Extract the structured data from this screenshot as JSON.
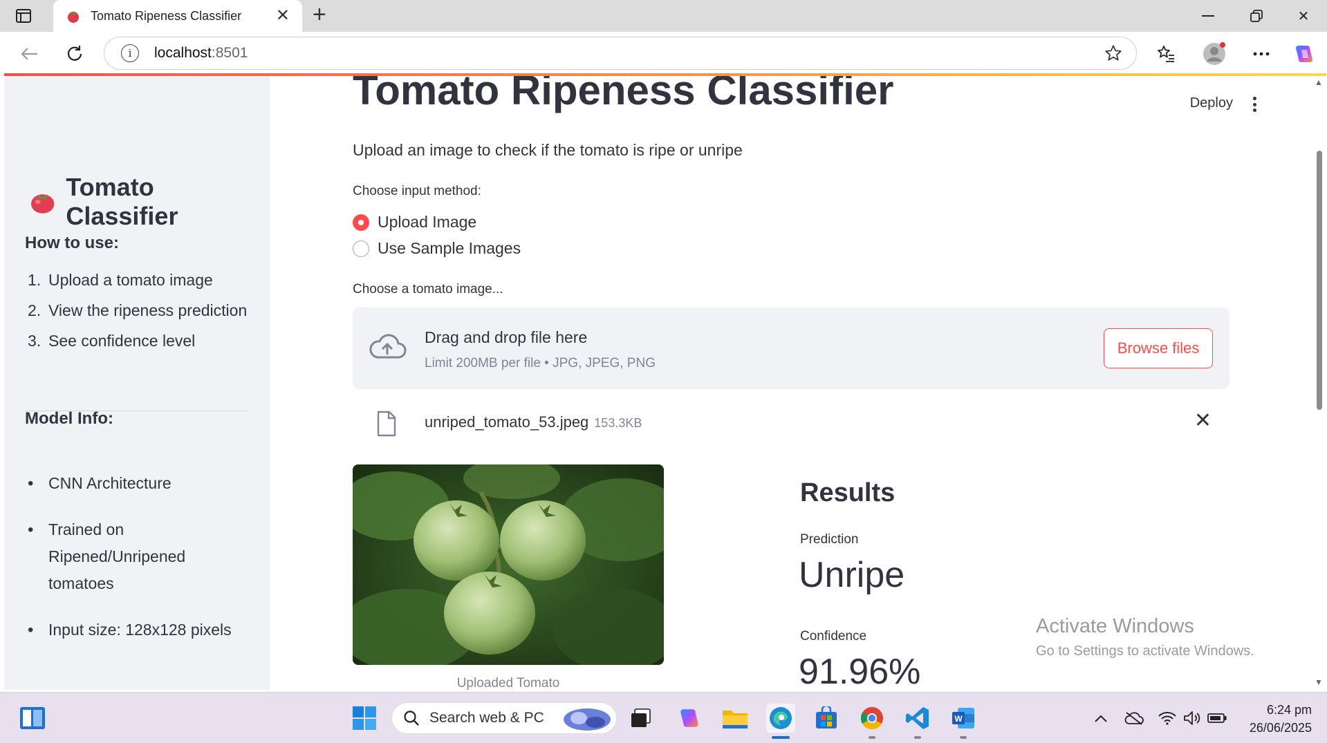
{
  "browser": {
    "tab_title": "Tomato Ripeness Classifier",
    "url_host": "localhost",
    "url_port": ":8501"
  },
  "sidebar": {
    "title": "Tomato Classifier",
    "how_to_heading": "How to use:",
    "steps": [
      {
        "num": "1.",
        "text": "Upload a tomato image"
      },
      {
        "num": "2.",
        "text": "View the ripeness prediction"
      },
      {
        "num": "3.",
        "text": "See confidence level"
      }
    ],
    "model_heading": "Model Info:",
    "model_info": [
      "CNN Architecture",
      "Trained on Ripened/Unripened tomatoes",
      "Input size: 128x128 pixels"
    ]
  },
  "header": {
    "deploy_label": "Deploy"
  },
  "main": {
    "title": "Tomato Ripeness Classifier",
    "subtitle": "Upload an image to check if the tomato is ripe or unripe",
    "input_method_label": "Choose input method:",
    "radio_options": [
      {
        "label": "Upload Image",
        "selected": true
      },
      {
        "label": "Use Sample Images",
        "selected": false
      }
    ],
    "uploader_label": "Choose a tomato image...",
    "dropzone_title": "Drag and drop file here",
    "dropzone_sub": "Limit 200MB per file • JPG, JPEG, PNG",
    "browse_label": "Browse files",
    "file_name": "unriped_tomato_53.jpeg",
    "file_size": "153.3KB",
    "image_caption": "Uploaded Tomato",
    "results_heading": "Results",
    "prediction_label": "Prediction",
    "prediction_value": "Unripe",
    "confidence_label": "Confidence",
    "confidence_value": "91.96%"
  },
  "watermark": {
    "line1": "Activate Windows",
    "line2": "Go to Settings to activate Windows."
  },
  "taskbar": {
    "search_placeholder": "Search web & PC",
    "time": "6:24 pm",
    "date": "26/06/2025"
  },
  "colors": {
    "accent": "#ff4b4b",
    "sidebar_bg": "#f0f2f6",
    "text": "#31333f",
    "muted": "#808495"
  }
}
